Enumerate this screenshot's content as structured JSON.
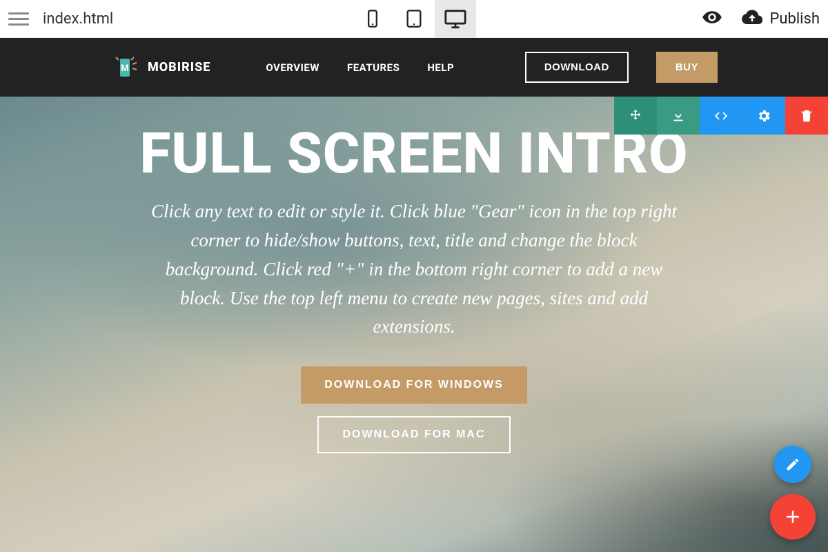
{
  "app_bar": {
    "filename": "index.html",
    "publish_label": "Publish",
    "active_device": "desktop"
  },
  "site_nav": {
    "logo_text": "MOBIRISE",
    "links": [
      "OVERVIEW",
      "FEATURES",
      "HELP"
    ],
    "download_label": "DOWNLOAD",
    "buy_label": "BUY"
  },
  "block_toolbar": {
    "icons": [
      "move",
      "save",
      "code",
      "gear",
      "delete"
    ]
  },
  "hero": {
    "title": "FULL SCREEN INTRO",
    "subtitle": "Click any text to edit or style it. Click blue \"Gear\" icon in the top right corner to hide/show buttons, text, title and change the block background. Click red \"+\" in the bottom right corner to add a new block. Use the top left menu to create new pages, sites and add extensions.",
    "btn_primary": "DOWNLOAD FOR WINDOWS",
    "btn_secondary": "DOWNLOAD FOR MAC"
  },
  "colors": {
    "accent": "#c49b66",
    "toolbar_blue": "#2196f3",
    "toolbar_red": "#f44336",
    "toolbar_teal": "#2d8f78"
  }
}
